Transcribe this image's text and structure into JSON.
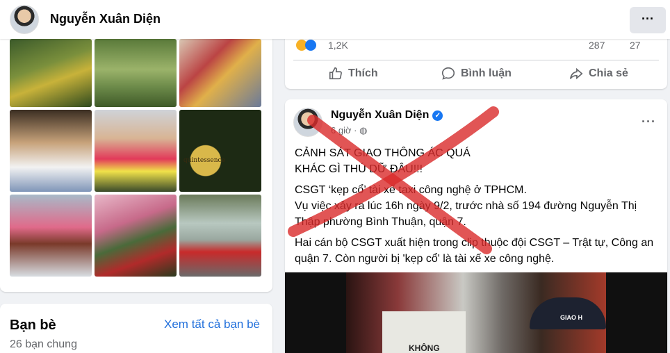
{
  "profile": {
    "name": "Nguyễn Xuân Diện"
  },
  "friends": {
    "title": "Bạn bè",
    "see_all": "Xem tất cả bạn bè",
    "mutual": "26 bạn chung"
  },
  "previous_post": {
    "reaction_count": "1,2K",
    "comment_count": "287",
    "share_count": "27",
    "actions": {
      "like": "Thích",
      "comment": "Bình luận",
      "share": "Chia sẻ"
    }
  },
  "post": {
    "author": "Nguyễn Xuân Diện",
    "time": "6 giờ",
    "line1": "CẢNH SÁT GIAO THÔNG ÁC QUÁ",
    "line2": "KHÁC GÌ THÚ DỮ ĐÂU!!!",
    "para1_l1": "CSGT ‘kẹp cổ’ tài xế taxi công nghệ ở TPHCM.",
    "para1_l2": "Vụ việc xảy ra lúc 16h ngày 9/2, trước nhà số 194 đường Nguyễn Thị",
    "para1_l3": "Thập phường Bình Thuận, quận 7.",
    "para2_l1": "Hai cán bộ CSGT xuất hiện trong clip thuộc đội CSGT – Trật tự, Công an",
    "para2_l2": "quận 7. Còn người bị 'kẹp cổ' là tài xế xe công nghệ.",
    "media_text_1": "quintessence",
    "media_text_2": "KHÔNG",
    "media_text_3": "GIAO H"
  },
  "colors": {
    "accent": "#216fdb",
    "verified": "#1877f2",
    "cross": "#d92b2b"
  },
  "icons": [
    "like-icon",
    "comment-icon",
    "share-icon",
    "verified-icon",
    "globe-icon",
    "more-icon"
  ]
}
